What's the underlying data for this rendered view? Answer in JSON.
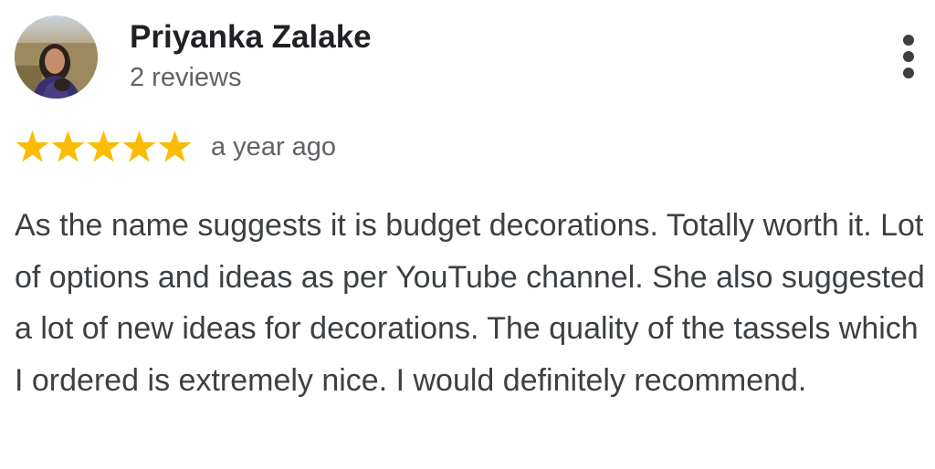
{
  "review": {
    "reviewer_name": "Priyanka Zalake",
    "review_count": "2 reviews",
    "avatar_icon": "profile-photo",
    "more_options_icon": "more-vert-icon",
    "rating": 5,
    "rating_max": 5,
    "star_color": "#FBBC04",
    "date": "a year ago",
    "text": "As the name suggests it is budget decorations. Totally worth it. Lot of options and ideas as per YouTube channel. She also suggested a lot of new ideas for decorations. The quality of the tassels which I ordered is extremely nice. I would definitely recommend."
  }
}
